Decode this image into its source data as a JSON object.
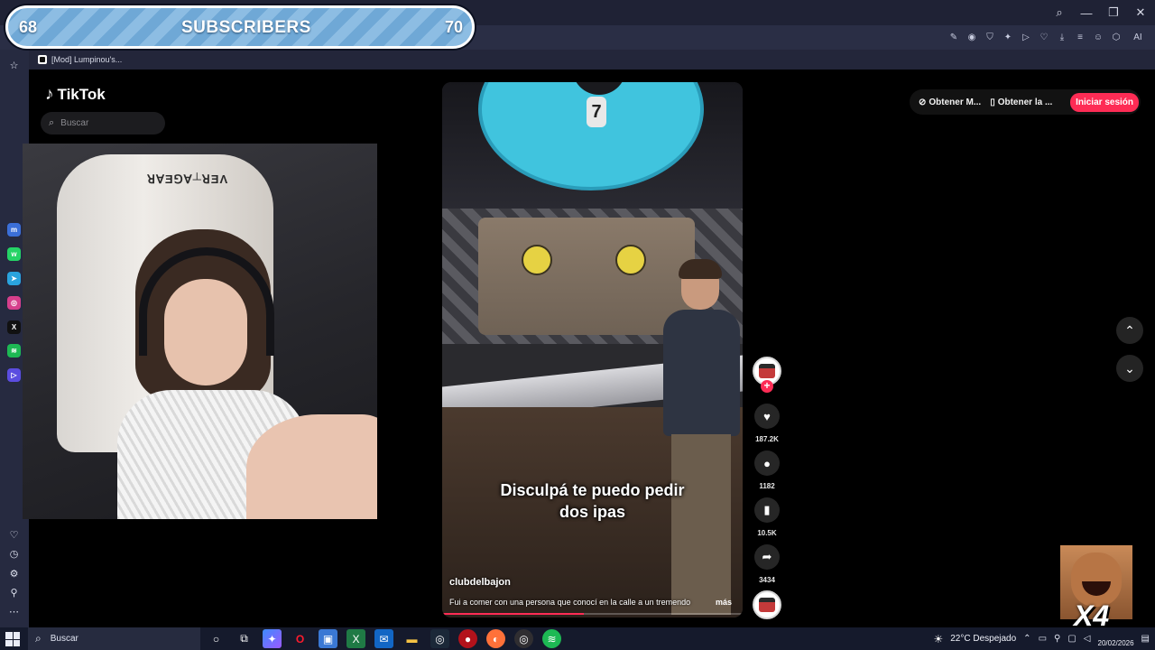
{
  "overlay": {
    "sub_left": "68",
    "sub_label": "SUBSCRIBERS",
    "sub_right": "70"
  },
  "browser": {
    "window_controls": [
      "search-icon",
      "minimize-icon",
      "restore-icon",
      "close-icon"
    ],
    "toolbar_icons": [
      "edit-icon",
      "camera-icon",
      "shield-icon",
      "extension-icon",
      "play-icon",
      "heart-icon",
      "download-icon",
      "menu-icon",
      "user-icon",
      "cube-icon"
    ],
    "ai_label": "AI",
    "bookmark": "[Mod] Lumpinou's..."
  },
  "sidebar": {
    "apps": [
      "messenger-icon",
      "whatsapp-icon",
      "telegram-icon",
      "instagram-icon",
      "x-icon",
      "spotify-icon",
      "player-icon"
    ],
    "bottom": [
      "heart-icon",
      "clock-icon",
      "settings-icon",
      "bulb-icon",
      "more-icon"
    ]
  },
  "tiktok": {
    "logo": "TikTok",
    "search_placeholder": "Buscar",
    "get_app_1": "Obtener M...",
    "get_app_2": "Obtener la ...",
    "login": "Iniciar sesión"
  },
  "video": {
    "caption_line1": "Disculpá te puedo pedir",
    "caption_line2": "dos ipas",
    "username": "clubdelbajon",
    "description": "Fui a comer con una persona que conocí en la calle a un tremendo",
    "more": "más",
    "progress": 0.47,
    "likes": "187.2K",
    "comments": "1182",
    "saves": "10.5K",
    "shares": "3434"
  },
  "meme": {
    "text": "X4"
  },
  "taskbar": {
    "search_placeholder": "Buscar",
    "apps": [
      "cortana-icon",
      "task-view-icon",
      "copilot-icon",
      "opera-icon",
      "store-icon",
      "excel-icon",
      "outlook-icon",
      "folder-icon",
      "steam-icon",
      "app-red-icon",
      "firefox-icon",
      "obs-icon",
      "spotify-icon"
    ],
    "weather": "22°C  Despejado",
    "date": "20/02/2026"
  },
  "colors": {
    "accent": "#fe2c55",
    "chrome": "#2a2e45",
    "sub_bar": "#6fa8d6"
  }
}
